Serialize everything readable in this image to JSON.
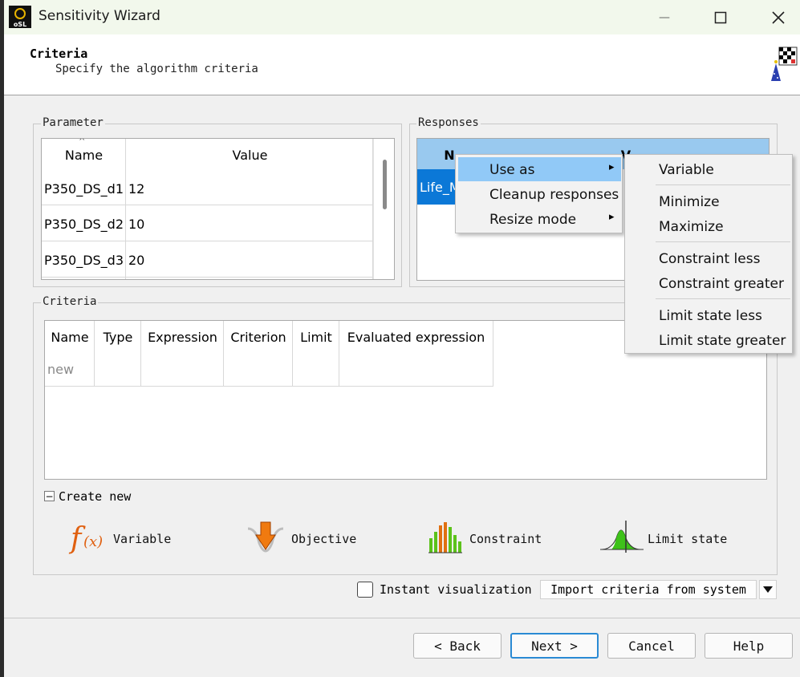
{
  "window": {
    "title": "Sensitivity Wizard",
    "minimize_glyph": "—",
    "maximize_glyph": "☐",
    "close_glyph": "✕",
    "app_icon_text": "oSL"
  },
  "header": {
    "title": "Criteria",
    "subtitle": "Specify the algorithm criteria"
  },
  "parameter": {
    "group_label": "Parameter",
    "columns": [
      "Name",
      "Value"
    ],
    "rows": [
      {
        "name": "P350_DS_d1",
        "value": "12"
      },
      {
        "name": "P350_DS_d2",
        "value": "10"
      },
      {
        "name": "P350_DS_d3",
        "value": "20"
      }
    ]
  },
  "responses": {
    "group_label": "Responses",
    "column_name": "N",
    "column_value": "V",
    "rows": [
      {
        "name": "Life_M"
      }
    ]
  },
  "context_menu": {
    "items": [
      "Use as",
      "Cleanup responses",
      "Resize mode"
    ],
    "submenu_arrow": "▸"
  },
  "submenu": {
    "groups": [
      [
        "Variable"
      ],
      [
        "Minimize",
        "Maximize"
      ],
      [
        "Constraint less",
        "Constraint greater"
      ],
      [
        "Limit state less",
        "Limit state greater"
      ]
    ]
  },
  "criteria": {
    "group_label": "Criteria",
    "columns": [
      "Name",
      "Type",
      "Expression",
      "Criterion",
      "Limit",
      "Evaluated expression"
    ],
    "new_row_placeholder": "new"
  },
  "create_new": {
    "toggle_glyph": "−",
    "label": "Create new",
    "items": [
      {
        "label": "Variable",
        "icon": "function-icon"
      },
      {
        "label": "Objective",
        "icon": "objective-icon"
      },
      {
        "label": "Constraint",
        "icon": "constraint-icon"
      },
      {
        "label": "Limit state",
        "icon": "limit-state-icon"
      }
    ]
  },
  "options": {
    "instant_visualization_label": "Instant visualization",
    "instant_visualization_checked": false,
    "import_button_label": "Import criteria from system"
  },
  "footer": {
    "back_label": "< Back",
    "next_label": "Next >",
    "cancel_label": "Cancel",
    "help_label": "Help"
  },
  "colors": {
    "selection": "#99c9ef",
    "menu_highlight": "#91c9f7",
    "titlebar": "#f2f8ec",
    "next_border": "#2a8ad4"
  }
}
